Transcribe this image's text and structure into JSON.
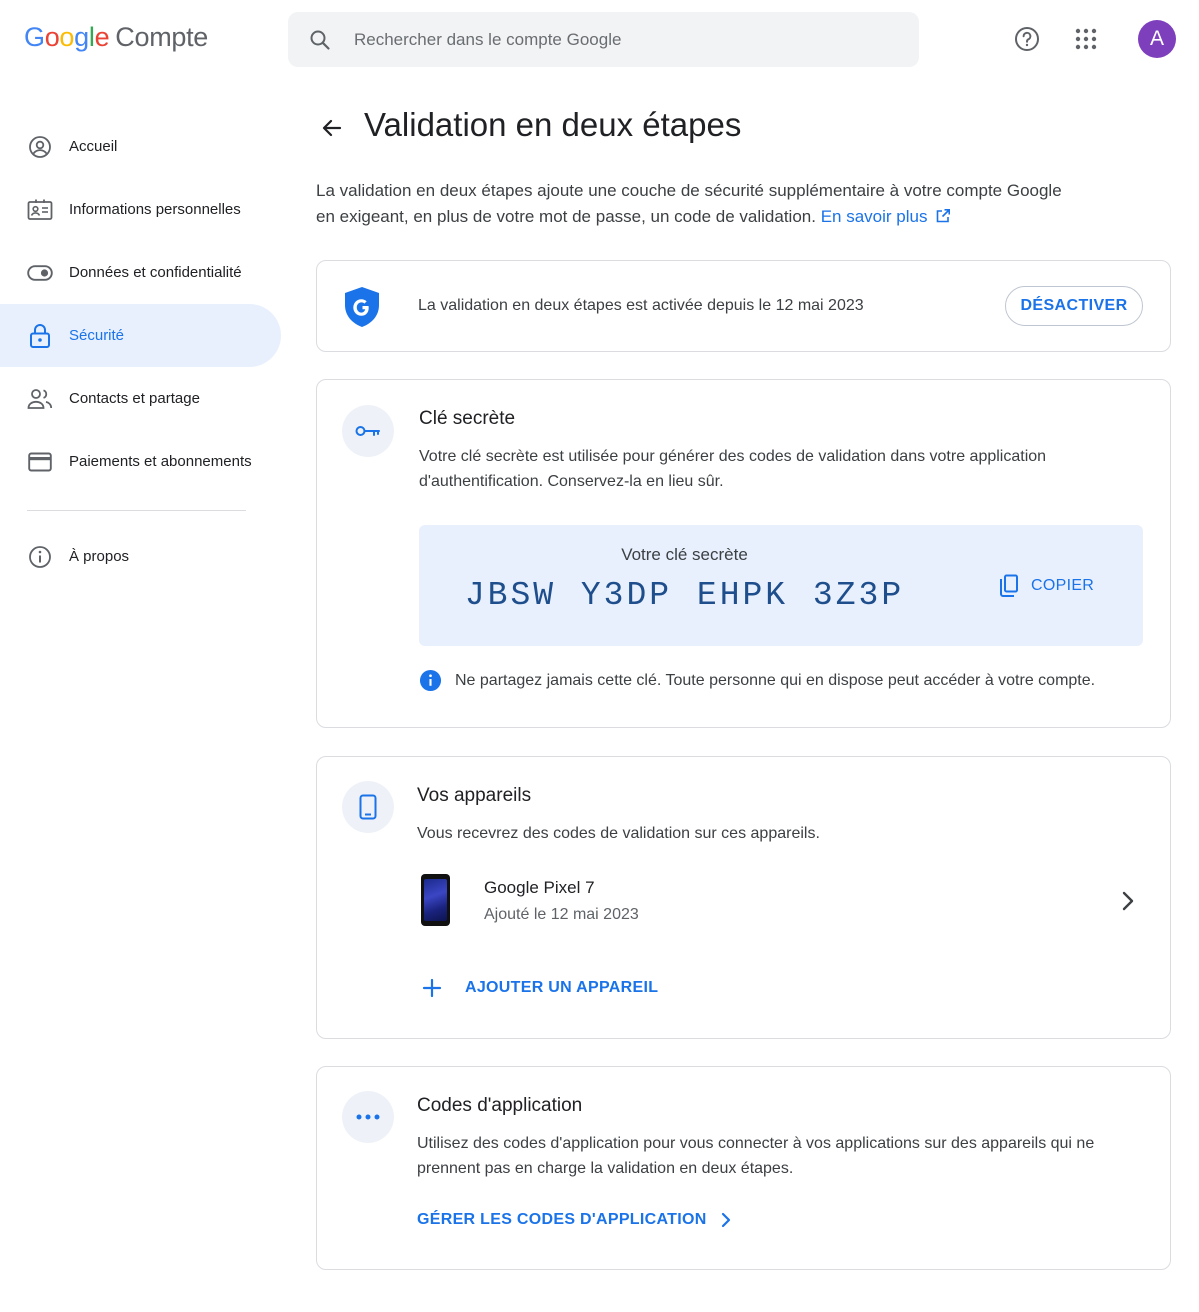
{
  "header": {
    "logo_letters": [
      "G",
      "o",
      "o",
      "g",
      "l",
      "e"
    ],
    "product": "Compte",
    "search_placeholder": "Rechercher dans le compte Google",
    "avatar_initial": "A"
  },
  "sidebar": {
    "items": [
      {
        "label": "Accueil",
        "icon": "account-circle-icon"
      },
      {
        "label": "Informations personnelles",
        "icon": "id-card-icon"
      },
      {
        "label": "Données et confidentialité",
        "icon": "toggle-icon"
      },
      {
        "label": "Sécurité",
        "icon": "lock-icon",
        "active": true
      },
      {
        "label": "Contacts et partage",
        "icon": "people-icon"
      },
      {
        "label": "Paiements et abonnements",
        "icon": "credit-card-icon"
      }
    ],
    "about": "À propos"
  },
  "page": {
    "title": "Validation en deux étapes",
    "intro_text": "La validation en deux étapes ajoute une couche de sécurité supplémentaire à votre compte Google en exigeant, en plus de votre mot de passe, un code de validation.",
    "intro_link": "En savoir plus"
  },
  "status": {
    "text": "La validation en deux étapes est activée depuis le 12 mai 2023",
    "button": "DÉSACTIVER"
  },
  "secret_key": {
    "title": "Clé secrète",
    "description": "Votre clé secrète est utilisée pour générer des codes de validation dans votre application d'authentification. Conservez-la en lieu sûr.",
    "box_label": "Votre clé secrète",
    "value": "JBSW Y3DP EHPK 3Z3P",
    "copy_label": "COPIER",
    "warning": "Ne partagez jamais cette clé. Toute personne qui en dispose peut accéder à votre compte."
  },
  "devices": {
    "title": "Vos appareils",
    "description": "Vous recevrez des codes de validation sur ces appareils.",
    "items": [
      {
        "name": "Google Pixel 7",
        "added": "Ajouté le 12 mai 2023"
      }
    ],
    "add_label": "AJOUTER UN APPAREIL"
  },
  "app_codes": {
    "title": "Codes d'application",
    "description": "Utilisez des codes d'application pour vous connecter à vos applications sur des appareils qui ne prennent pas en charge la validation en deux étapes.",
    "manage_label": "GÉRER LES CODES D'APPLICATION"
  },
  "colors": {
    "accent": "#1a73e8",
    "active_nav_bg": "#e8f0fe",
    "avatar": "#7e3fbd",
    "card_border": "#dadce0"
  }
}
